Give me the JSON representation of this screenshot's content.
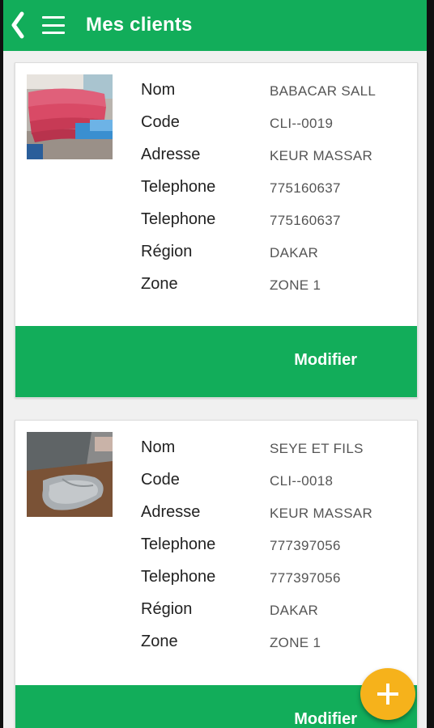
{
  "header": {
    "title": "Mes clients"
  },
  "icons": {
    "back": "back-chevron-icon",
    "menu": "hamburger-menu-icon",
    "fab": "plus-icon"
  },
  "colors": {
    "primary": "#12ad5a",
    "fab": "#f6b21b"
  },
  "clients": [
    {
      "fields": [
        {
          "label": "Nom",
          "value": "BABACAR SALL"
        },
        {
          "label": "Code",
          "value": "CLI--0019"
        },
        {
          "label": "Adresse",
          "value": "KEUR MASSAR"
        },
        {
          "label": "Telephone",
          "value": "775160637"
        },
        {
          "label": "Telephone",
          "value": "775160637"
        },
        {
          "label": "Région",
          "value": "DAKAR"
        },
        {
          "label": "Zone",
          "value": "ZONE 1"
        }
      ],
      "action": "Modifier"
    },
    {
      "fields": [
        {
          "label": "Nom",
          "value": "SEYE ET FILS"
        },
        {
          "label": "Code",
          "value": "CLI--0018"
        },
        {
          "label": "Adresse",
          "value": "KEUR MASSAR"
        },
        {
          "label": "Telephone",
          "value": "777397056"
        },
        {
          "label": "Telephone",
          "value": "777397056"
        },
        {
          "label": "Région",
          "value": "DAKAR"
        },
        {
          "label": "Zone",
          "value": "ZONE 1"
        }
      ],
      "action": "Modifier"
    }
  ]
}
